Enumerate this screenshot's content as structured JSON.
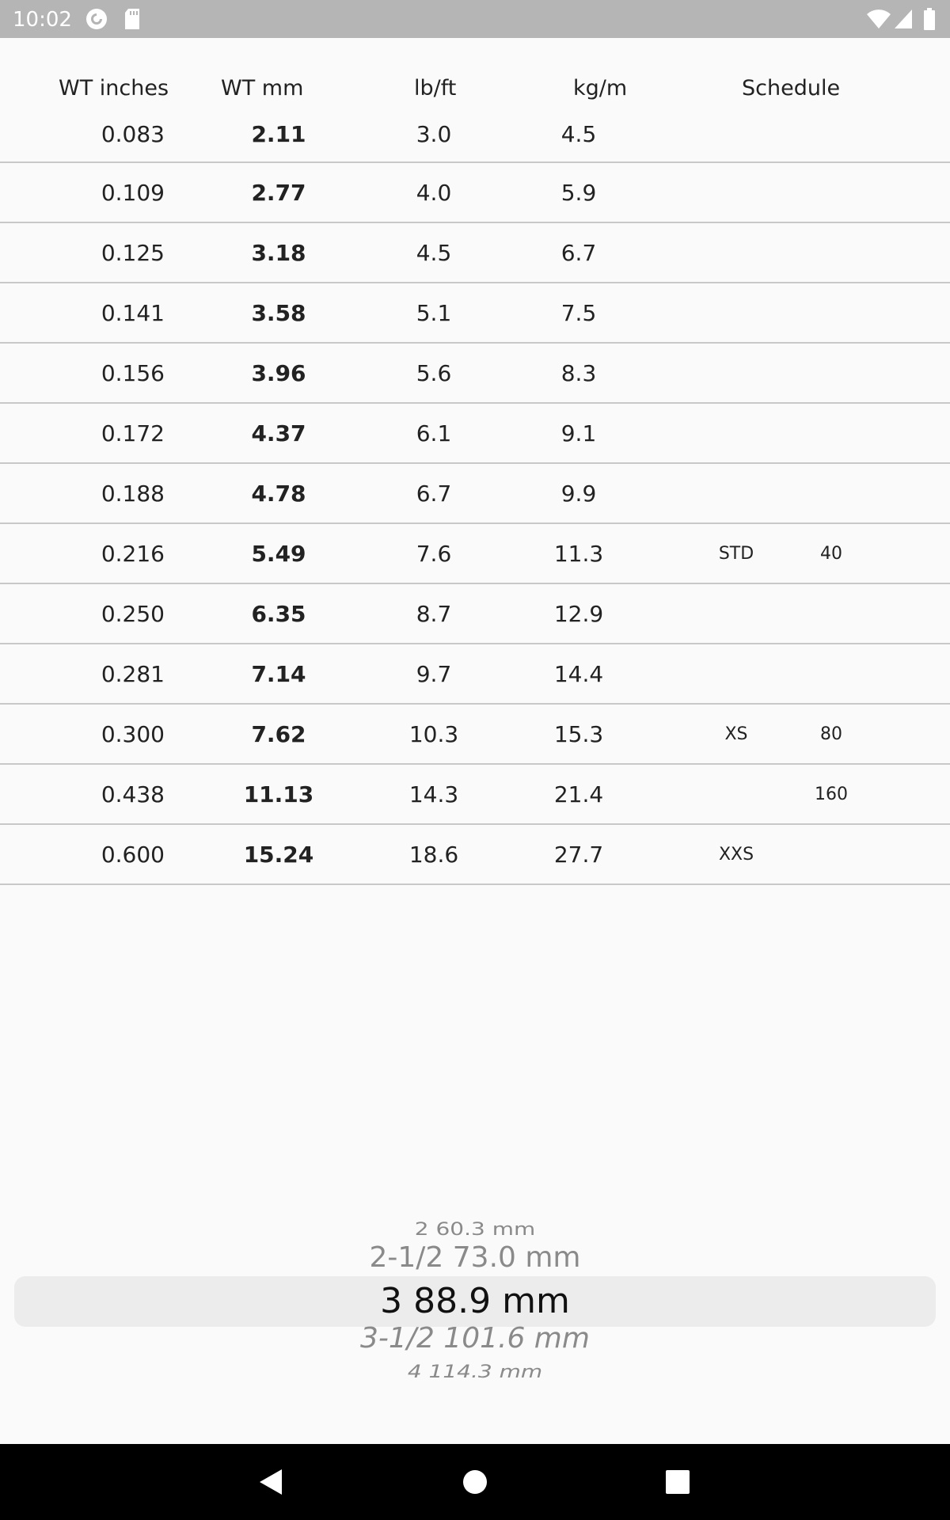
{
  "status_bar": {
    "time": "10:02",
    "left_icons": [
      "pocket-casts-icon",
      "sd-card-icon"
    ],
    "right_icons": [
      "wifi-icon",
      "cell-signal-icon",
      "battery-icon"
    ]
  },
  "table": {
    "headers": {
      "wt_inches": "WT inches",
      "wt_mm": "WT mm",
      "lb_ft": "lb/ft",
      "kg_m": "kg/m",
      "schedule": "Schedule"
    },
    "rows": [
      {
        "inches": "0.083",
        "mm": "2.11",
        "lbft": "3.0",
        "kgm": "4.5",
        "sched1": "",
        "sched2": ""
      },
      {
        "inches": "0.109",
        "mm": "2.77",
        "lbft": "4.0",
        "kgm": "5.9",
        "sched1": "",
        "sched2": ""
      },
      {
        "inches": "0.125",
        "mm": "3.18",
        "lbft": "4.5",
        "kgm": "6.7",
        "sched1": "",
        "sched2": ""
      },
      {
        "inches": "0.141",
        "mm": "3.58",
        "lbft": "5.1",
        "kgm": "7.5",
        "sched1": "",
        "sched2": ""
      },
      {
        "inches": "0.156",
        "mm": "3.96",
        "lbft": "5.6",
        "kgm": "8.3",
        "sched1": "",
        "sched2": ""
      },
      {
        "inches": "0.172",
        "mm": "4.37",
        "lbft": "6.1",
        "kgm": "9.1",
        "sched1": "",
        "sched2": ""
      },
      {
        "inches": "0.188",
        "mm": "4.78",
        "lbft": "6.7",
        "kgm": "9.9",
        "sched1": "",
        "sched2": ""
      },
      {
        "inches": "0.216",
        "mm": "5.49",
        "lbft": "7.6",
        "kgm": "11.3",
        "sched1": "STD",
        "sched2": "40"
      },
      {
        "inches": "0.250",
        "mm": "6.35",
        "lbft": "8.7",
        "kgm": "12.9",
        "sched1": "",
        "sched2": ""
      },
      {
        "inches": "0.281",
        "mm": "7.14",
        "lbft": "9.7",
        "kgm": "14.4",
        "sched1": "",
        "sched2": ""
      },
      {
        "inches": "0.300",
        "mm": "7.62",
        "lbft": "10.3",
        "kgm": "15.3",
        "sched1": "XS",
        "sched2": "80"
      },
      {
        "inches": "0.438",
        "mm": "11.13",
        "lbft": "14.3",
        "kgm": "21.4",
        "sched1": "",
        "sched2": "160"
      },
      {
        "inches": "0.600",
        "mm": "15.24",
        "lbft": "18.6",
        "kgm": "27.7",
        "sched1": "XXS",
        "sched2": ""
      }
    ]
  },
  "picker": {
    "items": [
      "2  60.3 mm",
      "2-1/2  73.0 mm",
      "3  88.9 mm",
      "3-1/2  101.6 mm",
      "4  114.3 mm"
    ],
    "selected_index": 2
  },
  "nav_bar": {
    "buttons": [
      "back-icon",
      "home-icon",
      "recents-icon"
    ]
  }
}
